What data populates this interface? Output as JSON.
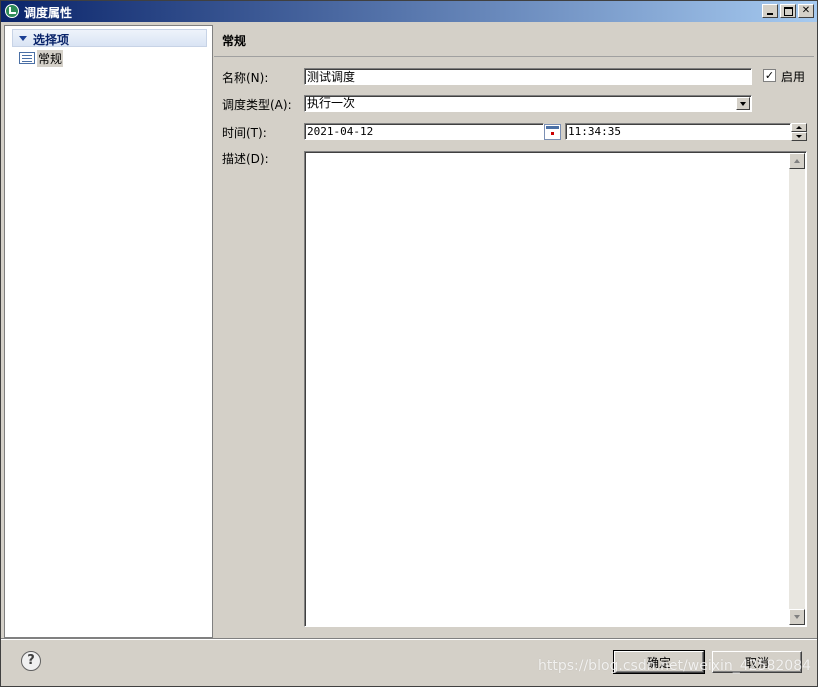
{
  "window": {
    "title": "调度属性"
  },
  "sidebar": {
    "root": {
      "label": "选择项",
      "expanded": true
    },
    "items": [
      {
        "label": "常规",
        "selected": true
      }
    ]
  },
  "section": {
    "title": "常规"
  },
  "form": {
    "name": {
      "label": "名称(N):",
      "value": "测试调度"
    },
    "enable": {
      "label": "启用",
      "checked": true
    },
    "schedule_type": {
      "label": "调度类型(A):",
      "value": "执行一次"
    },
    "time": {
      "label": "时间(T):",
      "date": "2021-04-12",
      "time": "11:34:35"
    },
    "description": {
      "label": "描述(D):",
      "value": ""
    }
  },
  "footer": {
    "ok_label": "确定",
    "cancel_label": "取消",
    "help_symbol": "?"
  },
  "watermark": "https://blog.csdn.net/weixin_42582084",
  "icons": {
    "app": "app-icon",
    "tree_expand": "triangle-down-icon",
    "page": "page-icon",
    "calendar": "calendar-icon",
    "help": "question-icon"
  },
  "colors": {
    "titlebar_start": "#0a246a",
    "titlebar_end": "#a6caf0",
    "face": "#d4d0c8"
  }
}
